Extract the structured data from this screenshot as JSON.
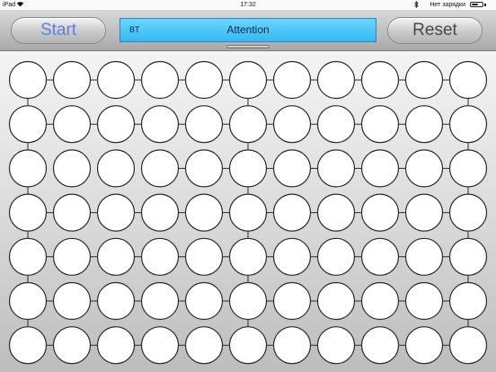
{
  "status_bar": {
    "device": "iPad",
    "time": "17:32",
    "charging_text": "Нет зарядки",
    "wifi_icon": "wifi-icon",
    "bluetooth_icon": "bluetooth-icon",
    "battery_level": 0.65
  },
  "toolbar": {
    "start_label": "Start",
    "reset_label": "Reset",
    "display": {
      "left_text": "BT",
      "center_text": "Attention"
    }
  },
  "colors": {
    "start_text": "#5f7ee6",
    "display_bg": "#45c3f8"
  },
  "board": {
    "rows": 7,
    "cols": 11,
    "horizontal_links": [
      [
        0,
        1,
        2,
        3,
        4,
        5,
        6,
        7,
        8,
        9
      ],
      [
        0,
        1,
        2,
        3,
        4,
        5,
        6,
        7,
        8,
        9
      ],
      [
        3,
        4,
        5,
        6,
        7,
        8,
        9
      ],
      [
        0,
        1,
        2,
        3,
        4,
        5,
        6,
        7,
        8,
        9
      ],
      [
        0,
        1,
        2,
        3,
        4,
        5,
        6,
        7,
        8,
        9
      ],
      [
        0,
        1,
        2,
        3,
        4,
        5,
        6,
        7,
        8,
        9
      ],
      [
        0,
        1,
        2,
        3,
        4,
        5,
        6,
        7,
        8,
        9
      ]
    ],
    "vertical_link_columns": [
      0,
      5,
      10
    ]
  }
}
